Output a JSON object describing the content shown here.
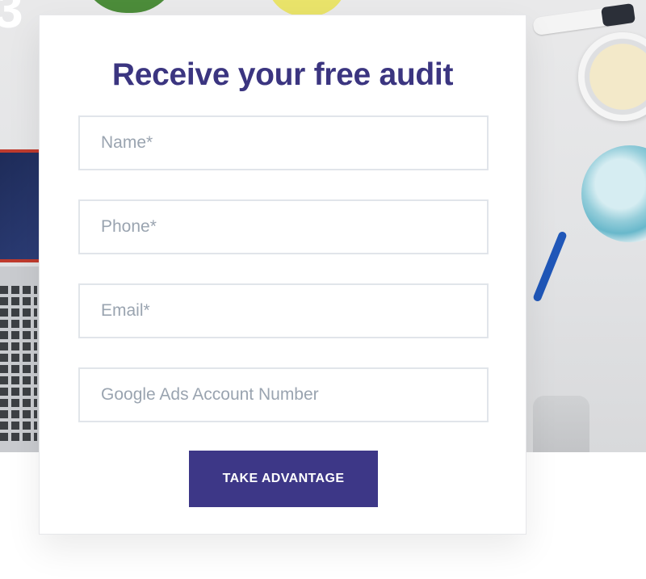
{
  "hero": {
    "partial_letter": "3"
  },
  "form": {
    "title": "Receive your free audit",
    "fields": {
      "name_placeholder": "Name*",
      "phone_placeholder": "Phone*",
      "email_placeholder": "Email*",
      "google_ads_placeholder": "Google Ads Account Number"
    },
    "submit_label": "TAKE ADVANTAGE"
  },
  "colors": {
    "accent": "#3d3787",
    "title": "#3b3580",
    "placeholder": "#9aa4b0",
    "field_border": "#e1e5ea"
  }
}
